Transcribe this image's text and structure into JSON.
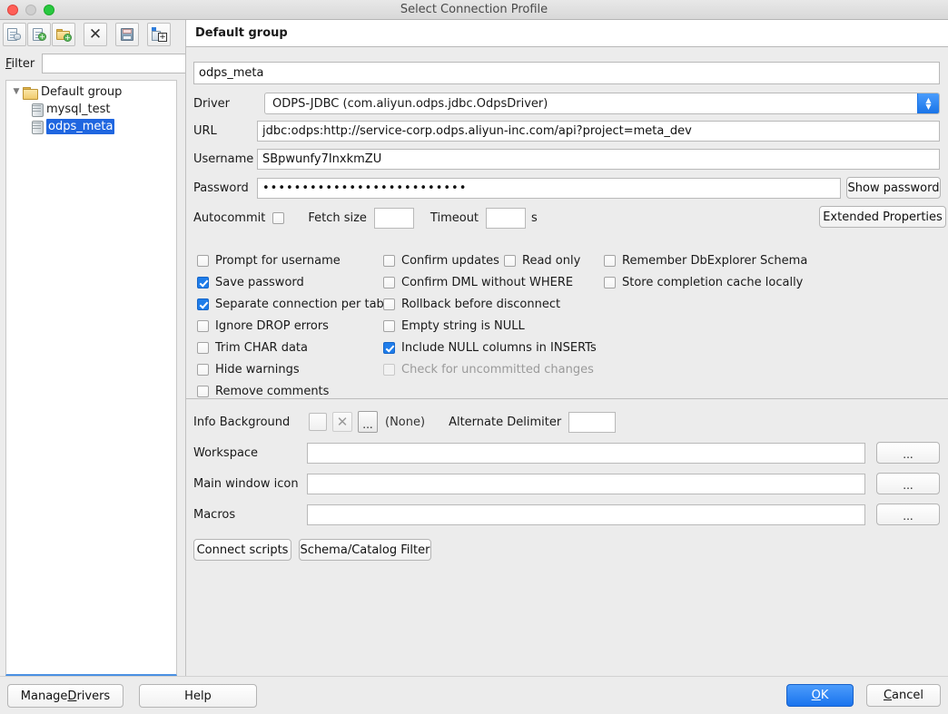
{
  "window": {
    "title": "Select Connection Profile",
    "controls": [
      "close",
      "minimize",
      "zoom"
    ]
  },
  "toolbar": {
    "buttons": [
      {
        "name": "new-connection-profile",
        "icon": "document-copy-icon"
      },
      {
        "name": "copy-profile",
        "icon": "document-add-icon"
      },
      {
        "name": "new-group",
        "icon": "folder-add-icon"
      },
      {
        "name": "delete-profile",
        "icon": "x-icon"
      },
      {
        "name": "save-profiles",
        "icon": "floppy-disk-icon"
      },
      {
        "name": "new-profile-in-group",
        "icon": "profile-add-icon"
      }
    ]
  },
  "filter": {
    "label": "Filter",
    "label_mnemonic": "F",
    "label_rest": "ilter",
    "value": "",
    "placeholder": ""
  },
  "tree": {
    "group_label": "Default group",
    "items": [
      {
        "label": "mysql_test",
        "selected": false
      },
      {
        "label": "odps_meta",
        "selected": true
      }
    ]
  },
  "group_header": "Default group",
  "profile": {
    "name_value": "odps_meta",
    "driver": {
      "label": "Driver",
      "value": "ODPS-JDBC (com.aliyun.odps.jdbc.OdpsDriver)"
    },
    "url": {
      "label": "URL",
      "value": "jdbc:odps:http://service-corp.odps.aliyun-inc.com/api?project=meta_dev"
    },
    "username": {
      "label": "Username",
      "value": "SBpwunfy7InxkmZU"
    },
    "password": {
      "label": "Password",
      "value": "••••••••••••••••••••••••••",
      "show_button": "Show password"
    },
    "autocommit": {
      "label": "Autocommit",
      "checked": false
    },
    "fetch_size": {
      "label": "Fetch size",
      "value": ""
    },
    "timeout": {
      "label": "Timeout",
      "value": "",
      "unit": "s"
    },
    "extended_properties_button": "Extended Properties"
  },
  "options": {
    "column1": [
      {
        "label": "Prompt for username",
        "checked": false,
        "enabled": true
      },
      {
        "label": "Save password",
        "checked": true,
        "enabled": true
      },
      {
        "label": "Separate connection per tab",
        "checked": true,
        "enabled": true
      },
      {
        "label": "Ignore DROP errors",
        "checked": false,
        "enabled": true
      },
      {
        "label": "Trim CHAR data",
        "checked": false,
        "enabled": true
      },
      {
        "label": "Hide warnings",
        "checked": false,
        "enabled": true
      },
      {
        "label": "Remove comments",
        "checked": false,
        "enabled": true
      }
    ],
    "column2": [
      {
        "label": "Confirm updates",
        "checked": false,
        "enabled": true
      },
      {
        "label": "Confirm DML without WHERE",
        "checked": false,
        "enabled": true
      },
      {
        "label": "Rollback before disconnect",
        "checked": false,
        "enabled": true
      },
      {
        "label": "Empty string is NULL",
        "checked": false,
        "enabled": true
      },
      {
        "label": "Include NULL columns in INSERTs",
        "checked": true,
        "enabled": true
      },
      {
        "label": "Check for uncommitted changes",
        "checked": false,
        "enabled": false
      }
    ],
    "column2b": [
      {
        "label": "Read only",
        "checked": false,
        "enabled": true
      }
    ],
    "column3": [
      {
        "label": "Remember DbExplorer Schema",
        "checked": false,
        "enabled": true
      },
      {
        "label": "Store completion cache locally",
        "checked": false,
        "enabled": true
      }
    ]
  },
  "appearance": {
    "info_background_label": "Info Background",
    "info_background_value": "(None)",
    "clear_color_icon": "x-icon",
    "choose_color_button": "...",
    "alternate_delimiter_label": "Alternate Delimiter",
    "alternate_delimiter_value": "",
    "workspace_label": "Workspace",
    "workspace_value": "",
    "workspace_browse": "...",
    "main_window_icon_label": "Main window icon",
    "main_window_icon_value": "",
    "main_window_icon_browse": "...",
    "macros_label": "Macros",
    "macros_value": "",
    "macros_browse": "..."
  },
  "bottom_buttons": {
    "connect_scripts": "Connect scripts",
    "schema_catalog_filter": "Schema/Catalog Filter"
  },
  "footer": {
    "manage_drivers": "Manage Drivers",
    "manage_drivers_mnemonic": "D",
    "manage_drivers_pre": "Manage ",
    "manage_drivers_post": "rivers",
    "help": "Help",
    "ok": "OK",
    "ok_mnemonic": "O",
    "ok_post": "K",
    "cancel": "Cancel",
    "cancel_mnemonic": "C",
    "cancel_post": "ancel"
  },
  "colors": {
    "accent_blue": "#1f7dea",
    "selection_blue": "#1f66e0",
    "ok_button": "#2a82f0",
    "window_bg": "#ececec"
  }
}
